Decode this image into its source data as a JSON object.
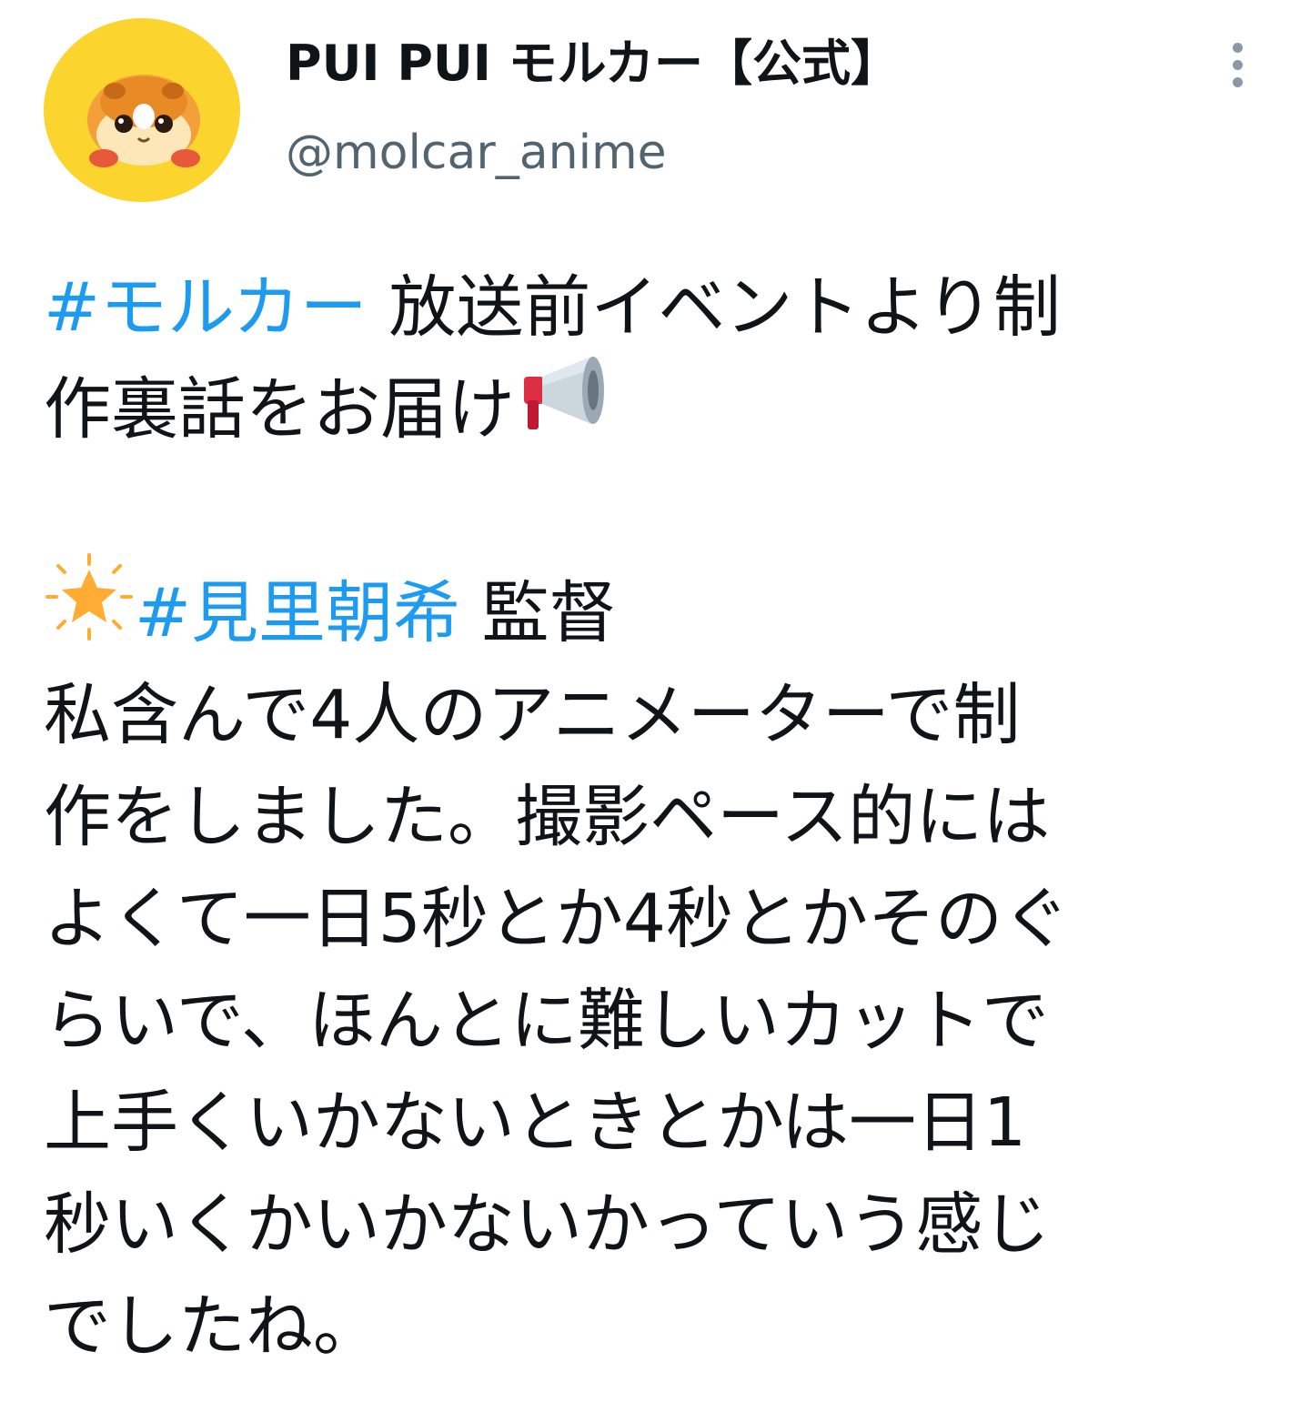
{
  "tweet": {
    "author": {
      "display_name": "PUI PUI モルカー【公式】",
      "handle": "@molcar_anime"
    },
    "body": {
      "line1_hashtag": "#モルカー",
      "line1_text": " 放送前イベントより制",
      "line2_text": "作裏話をお届け",
      "line2_emoji": "megaphone-icon",
      "line3_emoji": "glowing-star-icon",
      "line3_hashtag": "#見里朝希",
      "line3_text": " 監督",
      "line4": "私含んで4人のアニメーターで制",
      "line5": "作をしました。撮影ペース的には",
      "line6": "よくて一日5秒とか4秒とかそのぐ",
      "line7": "らいで、ほんとに難しいカットで",
      "line8": "上手くいかないときとかは一日1",
      "line9": "秒いくかいかないかっていう感じ",
      "line10": "でしたね。"
    }
  },
  "colors": {
    "hashtag": "#1d9bf0",
    "handle": "#536471",
    "text": "#0f1419",
    "avatar_bg": "#fbd52e"
  }
}
